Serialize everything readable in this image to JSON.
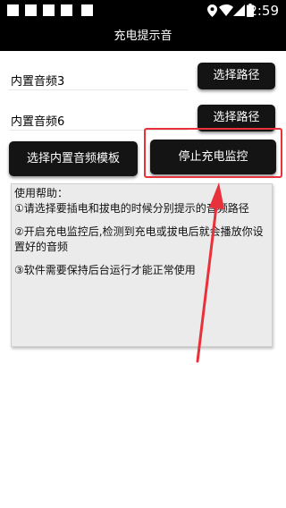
{
  "status_bar": {
    "time": "2:59",
    "notification_icons": [
      "square-icon",
      "square-icon",
      "square-icon",
      "square-icon",
      "square-icon"
    ],
    "system_icons": [
      "location-icon",
      "wifi-icon",
      "signal-icon",
      "battery-icon"
    ]
  },
  "app": {
    "title": "充电提示音"
  },
  "rows": [
    {
      "label": "内置音频3",
      "button": "选择路径"
    },
    {
      "label": "内置音频6",
      "button": "选择路径"
    }
  ],
  "actions": {
    "template_button": "选择内置音频模板",
    "stop_button": "停止充电监控"
  },
  "help": {
    "title": "使用帮助：",
    "lines": [
      "①请选择要插电和拔电的时候分别提示的音频路径",
      "②开启充电监控后,检测到充电或拔电后就会播放你设置好的音频",
      "③软件需要保持后台运行才能正常使用"
    ]
  },
  "colors": {
    "bar": "#000000",
    "button": "#141414",
    "highlight": "#e8313a",
    "help_bg": "#ebebeb"
  }
}
